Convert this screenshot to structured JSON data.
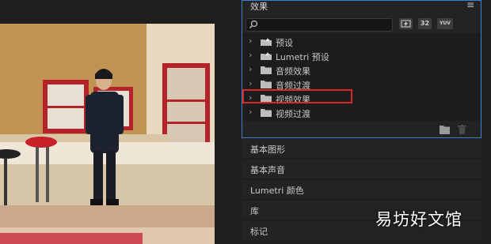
{
  "effects_panel": {
    "title": "效果",
    "menu_icon": "hamburger-menu-icon",
    "search": {
      "value": "",
      "placeholder": ""
    },
    "filter_buttons": [
      {
        "label": "",
        "icon": "accelerated-effects-icon"
      },
      {
        "label": "32",
        "icon": "32bit-effects-icon"
      },
      {
        "label": "YUV",
        "icon": "yuv-effects-icon"
      }
    ],
    "tree": [
      {
        "label": "预设",
        "icon": "preset-folder-icon"
      },
      {
        "label": "Lumetri 预设",
        "icon": "preset-folder-icon"
      },
      {
        "label": "音频效果",
        "icon": "folder-icon"
      },
      {
        "label": "音频过渡",
        "icon": "folder-icon"
      },
      {
        "label": "视频效果",
        "icon": "folder-icon",
        "highlighted": true
      },
      {
        "label": "视频过渡",
        "icon": "folder-icon"
      }
    ],
    "footer_icons": [
      "new-bin-icon",
      "delete-icon"
    ],
    "accent_color": "#3c80d0",
    "highlight_color": "#d42a2a"
  },
  "collapsed_panels": [
    {
      "label": "基本图形"
    },
    {
      "label": "基本声音"
    },
    {
      "label": "Lumetri 颜色"
    },
    {
      "label": "库"
    },
    {
      "label": "标记"
    }
  ],
  "watermark": "易坊好文馆"
}
